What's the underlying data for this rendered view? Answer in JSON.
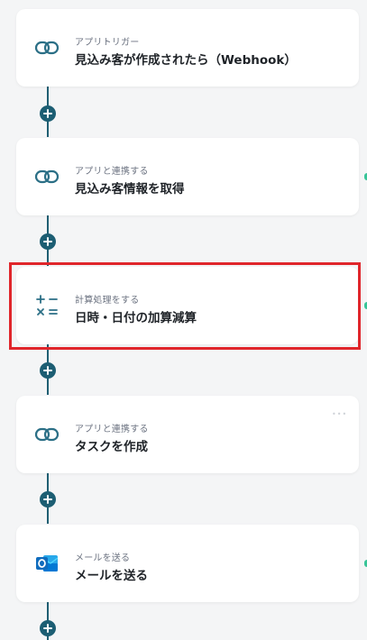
{
  "steps": [
    {
      "category": "アプリトリガー",
      "title": "見込み客が作成されたら（Webhook）",
      "icon": "chain-link-icon"
    },
    {
      "category": "アプリと連携する",
      "title": "見込み客情報を取得",
      "icon": "chain-link-icon"
    },
    {
      "category": "計算処理をする",
      "title": "日時・日付の加算減算",
      "icon": "calculator-operators-icon"
    },
    {
      "category": "アプリと連携する",
      "title": "タスクを作成",
      "icon": "chain-link-icon"
    },
    {
      "category": "メールを送る",
      "title": "メールを送る",
      "icon": "outlook-icon"
    }
  ],
  "colors": {
    "accent": "#1c5e73",
    "highlight": "#e0262b",
    "link_icon": "#2b6f86",
    "outlook": "#0f6cbd",
    "status_dot": "#37c497"
  }
}
